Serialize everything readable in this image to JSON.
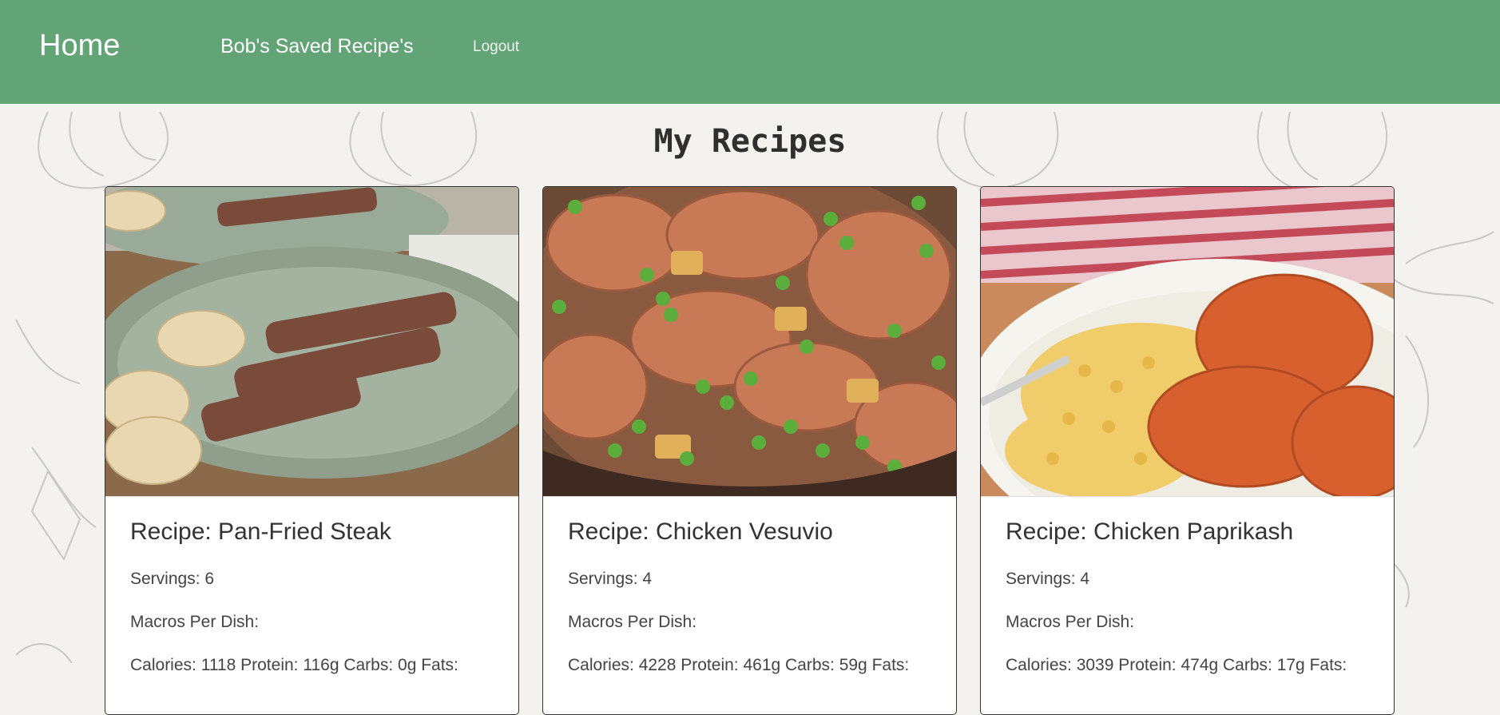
{
  "nav": {
    "brand": "Home",
    "saved": "Bob's Saved Recipe's",
    "logout": "Logout"
  },
  "page": {
    "title": "My Recipes"
  },
  "recipes": [
    {
      "title": "Recipe: Pan-Fried Steak",
      "servings": "Servings: 6",
      "macros_label": "Macros Per Dish:",
      "macros": "Calories: 1118 Protein: 116g Carbs: 0g Fats:"
    },
    {
      "title": "Recipe: Chicken Vesuvio",
      "servings": "Servings: 4",
      "macros_label": "Macros Per Dish:",
      "macros": "Calories: 4228 Protein: 461g Carbs: 59g Fats:"
    },
    {
      "title": "Recipe: Chicken Paprikash",
      "servings": "Servings: 4",
      "macros_label": "Macros Per Dish:",
      "macros": "Calories: 3039 Protein: 474g Carbs: 17g Fats:"
    }
  ],
  "colors": {
    "navbar": "#63a476",
    "background": "#f3f2ef",
    "card_border": "#333333"
  }
}
